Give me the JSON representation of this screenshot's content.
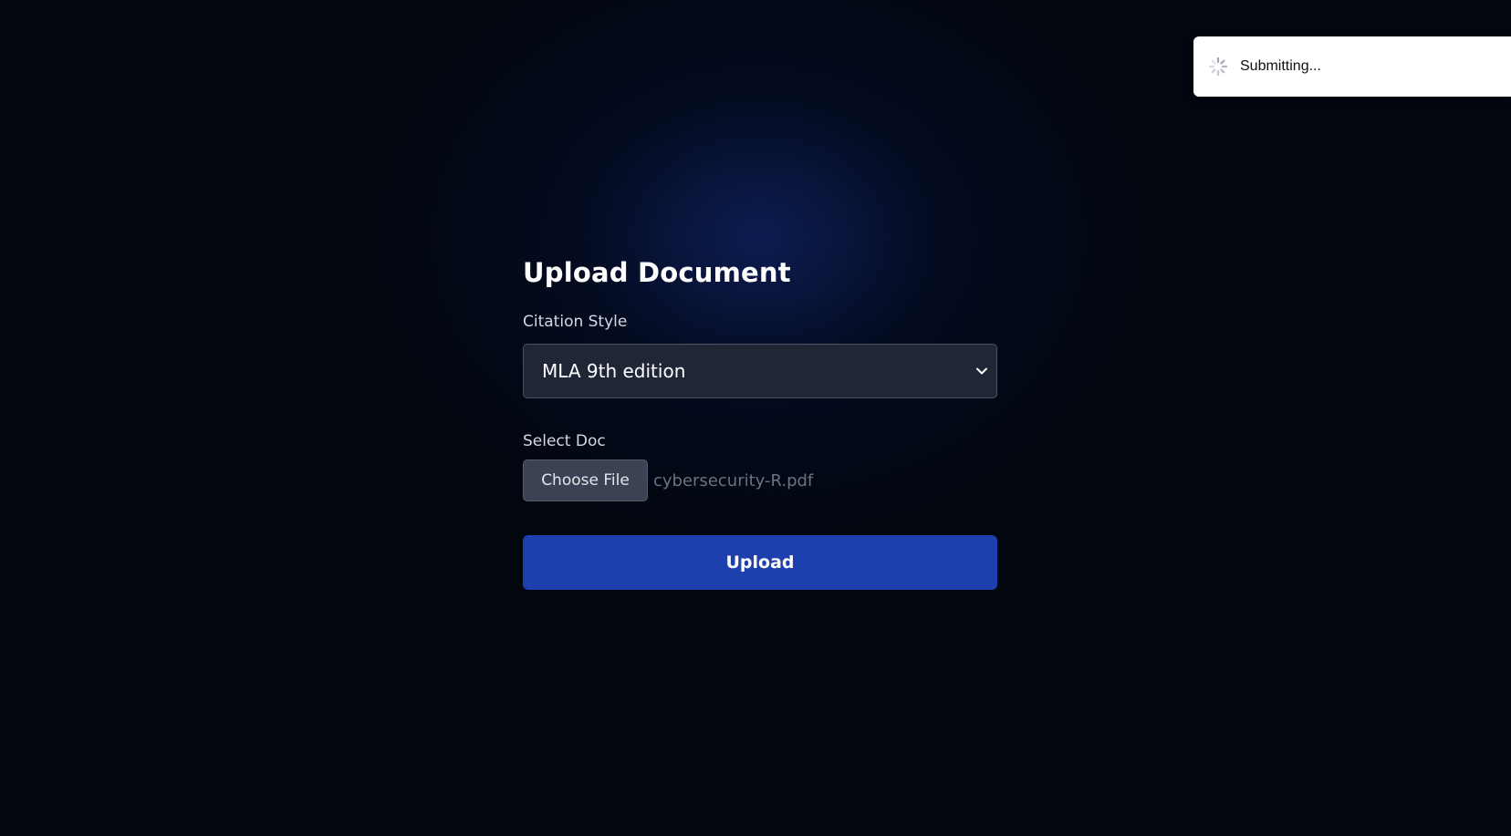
{
  "form": {
    "title": "Upload Document",
    "citation_label": "Citation Style",
    "citation_selected": "MLA 9th edition",
    "doc_label": "Select Doc",
    "choose_file_label": "Choose File",
    "file_name": "cybersecurity-R.pdf",
    "upload_label": "Upload"
  },
  "toast": {
    "message": "Submitting..."
  },
  "icons": {
    "select": "chevron-down-icon",
    "toast": "spinner-icon"
  },
  "colors": {
    "background": "#02060f",
    "accent": "#1e40af",
    "input_bg": "#1f2737",
    "file_button_bg": "#3a4253",
    "toast_bg": "#ffffff"
  }
}
